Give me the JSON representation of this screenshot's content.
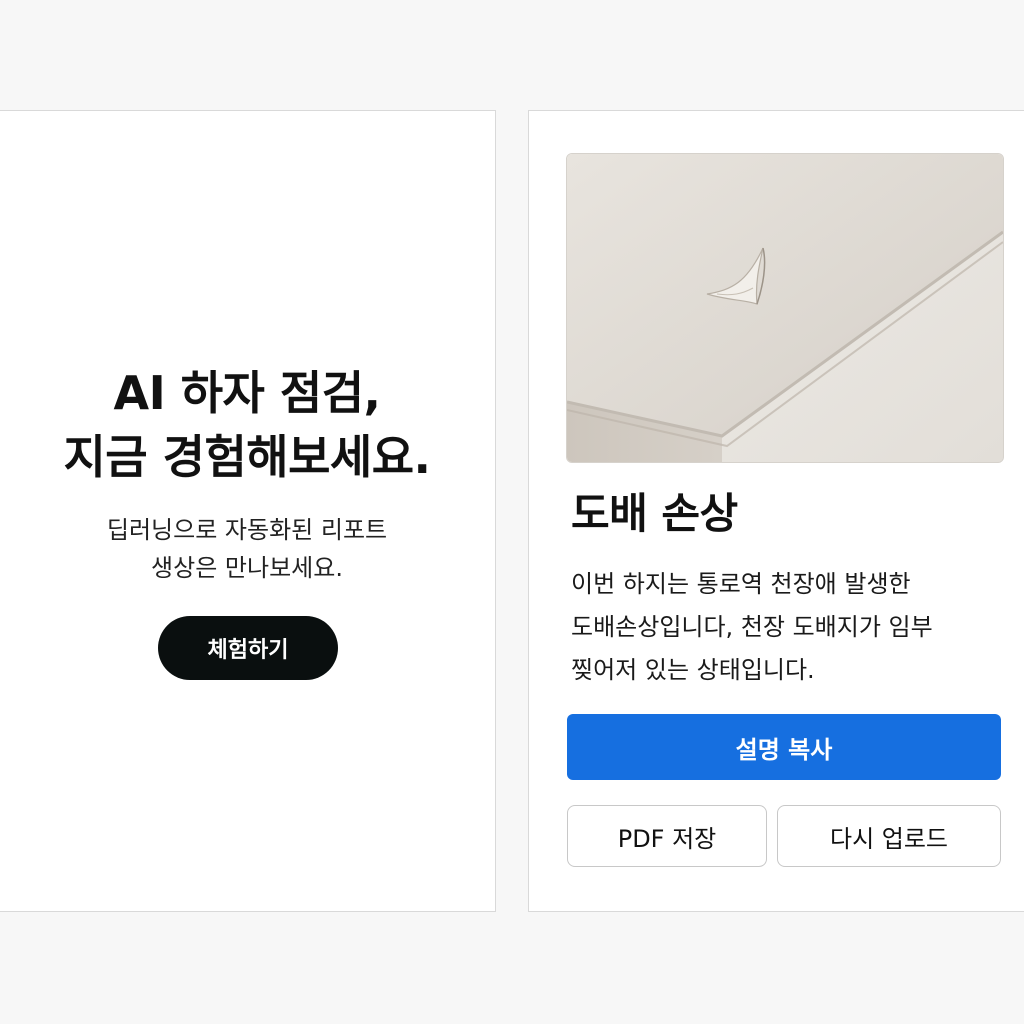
{
  "hero": {
    "title_line1": "AI 하자 점검,",
    "title_line2": "지금 경험해보세요.",
    "subtitle_line1": "딥러닝으로 자동화된 리포트",
    "subtitle_line2": "생상은 만나보세요.",
    "cta_label": "체험하기"
  },
  "result": {
    "image_icon": "ceiling-damage-photo",
    "title": "도배 손상",
    "description_line1": "이번 하지는 통로역 천장애 발생한",
    "description_line2": "도배손상입니다, 천장 도배지가 임부",
    "description_line3": "찢어저 있는 상태입니다.",
    "copy_label": "설명 복사",
    "pdf_label": "PDF 저장",
    "reupload_label": "다시 업로드"
  },
  "colors": {
    "background": "#f7f7f7",
    "cta_button": "#0a0f0f",
    "primary_button": "#166fe0",
    "card": "#ffffff"
  }
}
